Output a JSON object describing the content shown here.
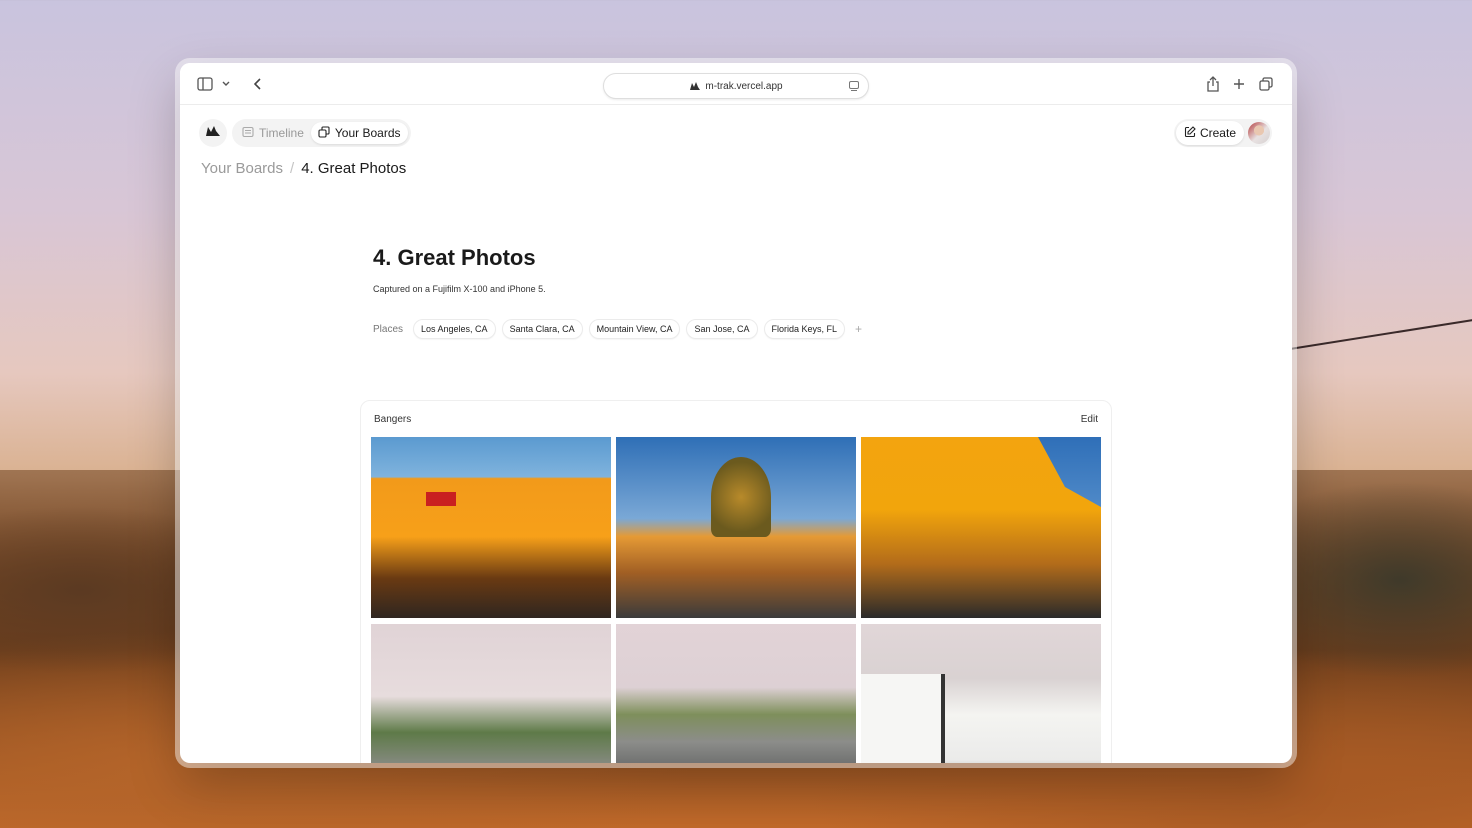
{
  "browser": {
    "url": "m-trak.vercel.app"
  },
  "nav": {
    "timeline_label": "Timeline",
    "boards_label": "Your Boards"
  },
  "actions": {
    "create_label": "Create"
  },
  "breadcrumb": {
    "root": "Your Boards",
    "separator": "/",
    "current": "4. Great Photos"
  },
  "board": {
    "title": "4. Great Photos",
    "description": "Captured on a Fujifilm X-100 and iPhone 5.",
    "places_label": "Places",
    "places": [
      "Los Angeles, CA",
      "Santa Clara, CA",
      "Mountain View, CA",
      "San Jose, CA",
      "Florida Keys, FL"
    ],
    "add_symbol": "+"
  },
  "collection": {
    "name": "Bangers",
    "edit_label": "Edit"
  },
  "colors": {
    "accent": "#1a1a1a",
    "muted": "#9a9a9a"
  },
  "icons": [
    "sidebar-icon",
    "chevron-down-icon",
    "back-icon",
    "share-icon",
    "plus-icon",
    "tabs-icon",
    "logo-icon",
    "timeline-icon",
    "boards-icon",
    "edit-icon"
  ]
}
